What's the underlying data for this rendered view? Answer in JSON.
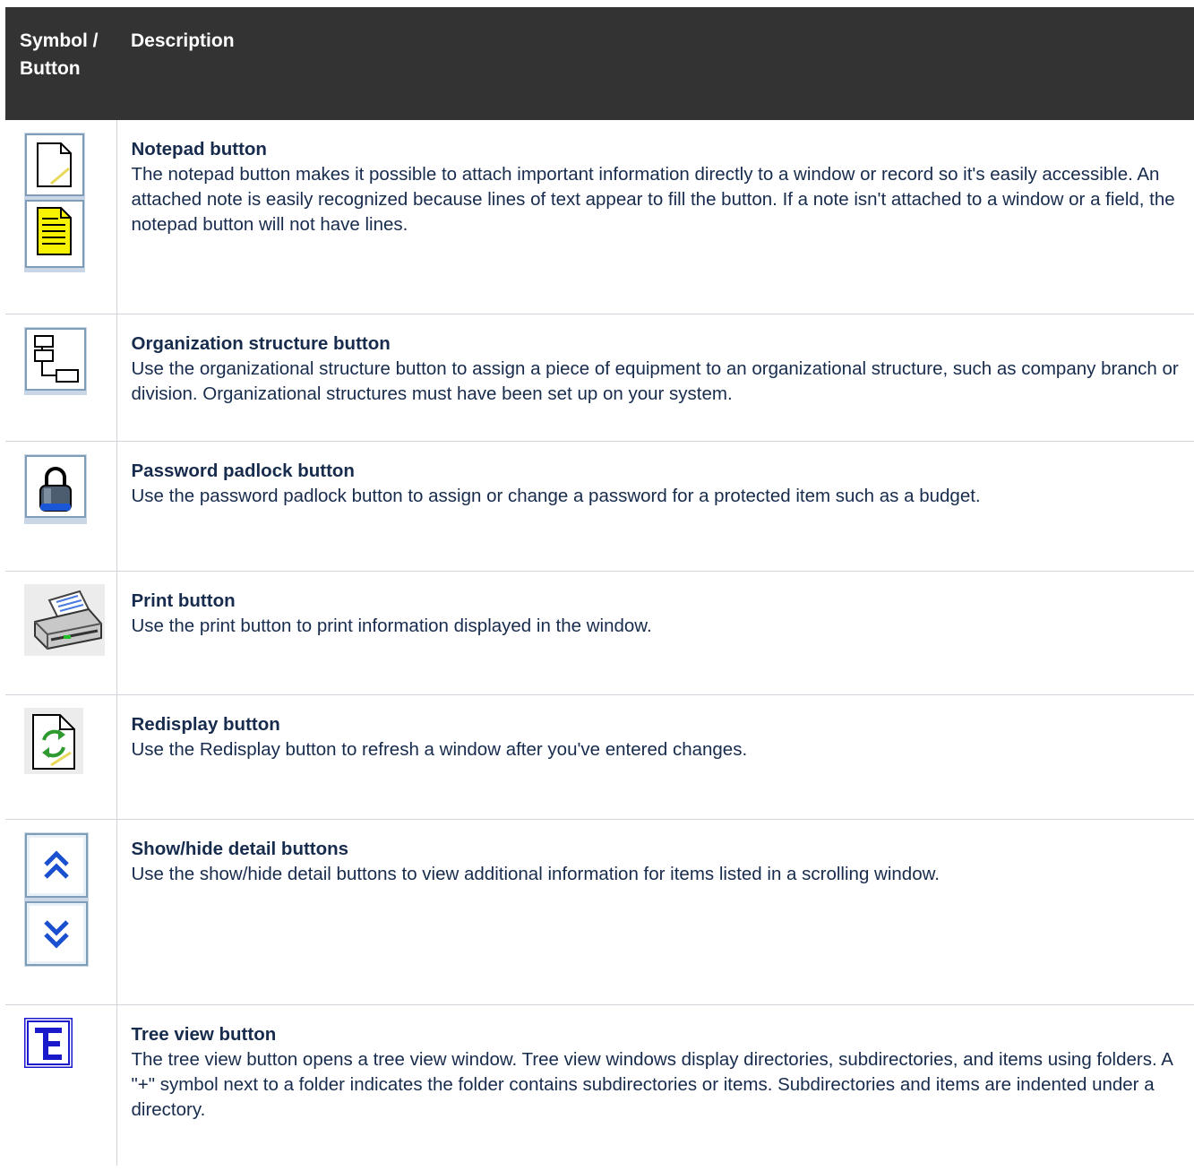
{
  "header": {
    "symbol_col": "Symbol / Button",
    "description_col": "Description"
  },
  "rows": [
    {
      "icon": "notepad-icons",
      "title": "Notepad button",
      "description": "The notepad button makes it possible to attach important information directly to a window or record so it's easily accessible. An attached note is easily recognized because lines of text appear to fill the button. If a note isn't attached to a window or a field, the notepad button will not have lines."
    },
    {
      "icon": "org-structure-icon",
      "title": "Organization structure button",
      "description": "Use the organizational structure button to assign a piece of equipment to an organizational structure, such as company branch or division. Organizational structures must have been set up on your system."
    },
    {
      "icon": "padlock-icon",
      "title": "Password padlock button",
      "description": "Use the password padlock button to assign or change a password for a protected item such as a budget."
    },
    {
      "icon": "printer-icon",
      "title": "Print button",
      "description": "Use the print button to print information displayed in the window."
    },
    {
      "icon": "redisplay-icon",
      "title": "Redisplay button",
      "description": "Use the Redisplay button to refresh a window after you've entered changes."
    },
    {
      "icon": "show-hide-icons",
      "title": "Show/hide detail buttons",
      "description": "Use the show/hide detail buttons to view additional information for items listed in a scrolling window."
    },
    {
      "icon": "tree-view-icon",
      "title": "Tree view button",
      "description": "The tree view button opens a tree view window. Tree view windows display directories, subdirectories, and items using folders. A \"+\" symbol next to a folder indicates the folder contains subdirectories or items. Subdirectories and items are indented under a directory."
    }
  ]
}
